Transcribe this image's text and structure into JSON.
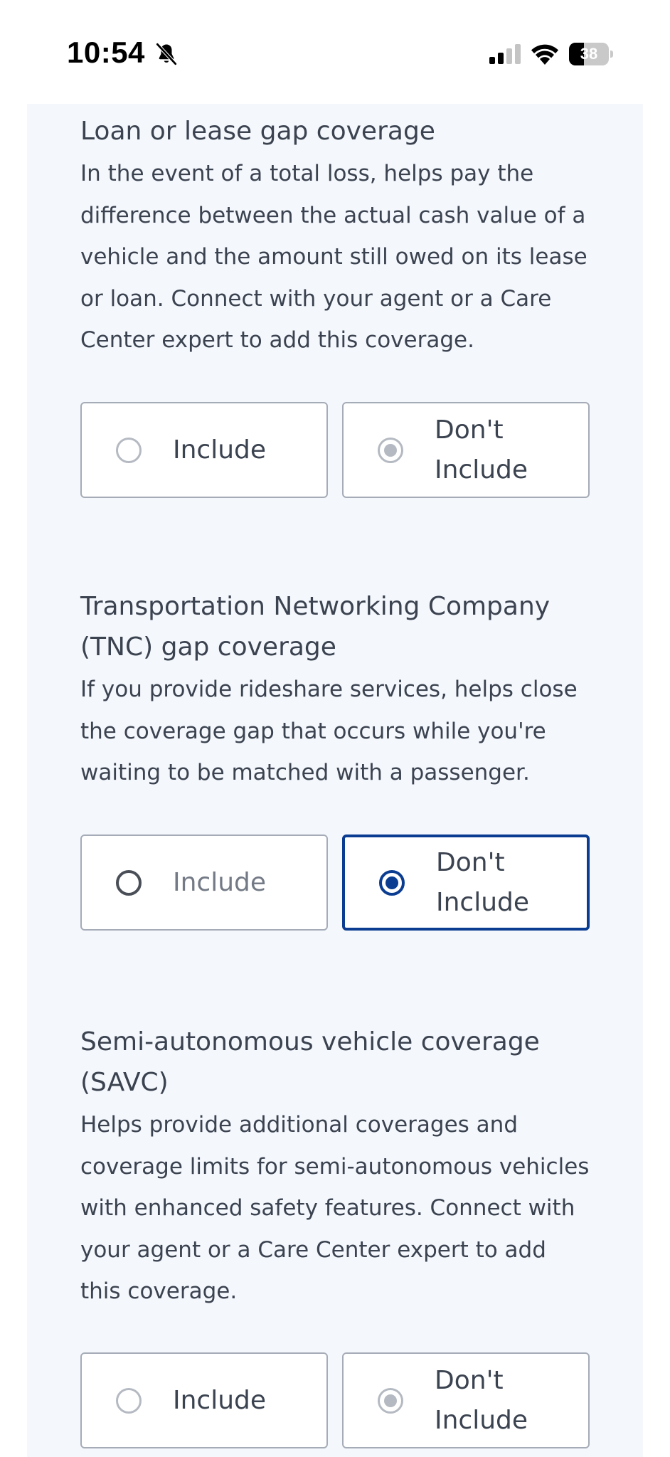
{
  "status_bar": {
    "time": "10:54",
    "battery_level": "38",
    "battery_fraction": 0.38,
    "icons": [
      "bell-slash-icon",
      "cellular-signal-icon",
      "wifi-icon",
      "battery-icon"
    ]
  },
  "sections": [
    {
      "title": "Loan or lease gap coverage",
      "description": "In the event of a total loss, helps pay the difference between the actual cash value of a vehicle and the amount still owed on its lease or loan. Connect with your agent or a Care Center expert to add this coverage.",
      "options": [
        {
          "label": "Include",
          "state": "disabled-unselected"
        },
        {
          "label": "Don't Include",
          "state": "disabled-selected"
        }
      ]
    },
    {
      "title": "Transportation Networking Company (TNC) gap coverage",
      "description": "If you provide rideshare services, helps close the coverage gap that occurs while you're waiting to be matched with a passenger.",
      "options": [
        {
          "label": "Include",
          "state": "unselected"
        },
        {
          "label": "Don't Include",
          "state": "selected"
        }
      ]
    },
    {
      "title": "Semi-autonomous vehicle coverage (SAVC)",
      "description": "Helps provide additional coverages and coverage limits for semi-autonomous vehicles with enhanced safety features. Connect with your agent or a Care Center expert to add this coverage.",
      "options": [
        {
          "label": "Include",
          "state": "disabled-unselected"
        },
        {
          "label": "Don't Include",
          "state": "disabled-selected"
        }
      ]
    }
  ],
  "colors": {
    "accent": "#0a3d91",
    "panel_background": "#f4f7fc",
    "text": "#3b4350",
    "border": "#a5acb7"
  }
}
